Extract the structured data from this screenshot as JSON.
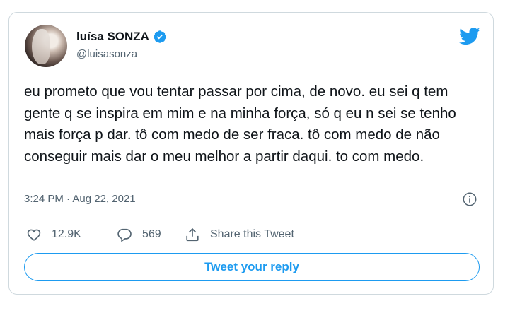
{
  "tweet": {
    "author_name": "luísa SONZA",
    "author_handle": "@luisasonza",
    "text": "eu prometo que vou tentar passar por cima, de novo. eu sei q tem gente q se inspira em mim e na minha força, só q eu n sei se tenho mais força p dar. tô com medo de ser fraca. tô com medo de não conseguir mais dar o meu melhor a partir daqui. to com medo.",
    "timestamp": "3:24 PM · Aug 22, 2021"
  },
  "actions": {
    "likes": "12.9K",
    "replies": "569",
    "share_label": "Share this Tweet"
  },
  "reply_button": "Tweet your reply",
  "colors": {
    "accent": "#1d9bf0",
    "muted": "#536471",
    "border": "#cfd9de"
  },
  "icons": [
    "verified-badge-icon",
    "twitter-bird-icon",
    "info-icon",
    "heart-icon",
    "reply-bubble-icon",
    "share-icon"
  ]
}
